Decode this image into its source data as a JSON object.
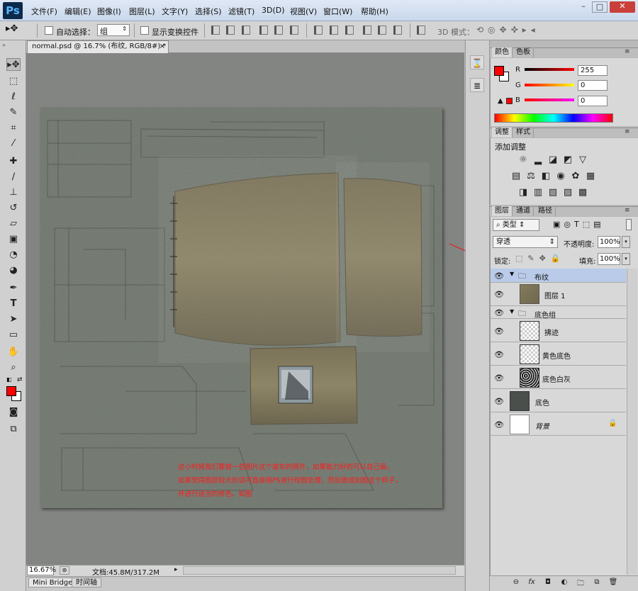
{
  "app": {
    "logo": "Ps"
  },
  "menu": [
    "文件(F)",
    "编辑(E)",
    "图像(I)",
    "图层(L)",
    "文字(Y)",
    "选择(S)",
    "滤镜(T)",
    "3D(D)",
    "视图(V)",
    "窗口(W)",
    "帮助(H)"
  ],
  "window_controls": {
    "minimize": "–",
    "maximize": "□",
    "close": "✕"
  },
  "options": {
    "auto_select_label": "自动选择：",
    "auto_select_value": "组",
    "show_transform_label": "显示变换控件",
    "mode_3d_label": "3D 模式："
  },
  "document": {
    "tab_title": "normal.psd @ 16.7% (布纹, RGB/8#) *",
    "annotation_lines": [
      "这小时候我们要做一些图片这个崖布的照片，如果能力好的可以自己画，",
      "如果觉得图层较大的话可直接用PS进行校图处理，然后做成如图这个样子，",
      "并进行适当的修色。如图"
    ],
    "zoom": "16.67%",
    "doc_info": "文档:45.8M/317.2M"
  },
  "bottom_tabs": [
    "Mini Bridge",
    "时间轴"
  ],
  "color_panel": {
    "tabs": [
      "颜色",
      "色板"
    ],
    "channels": [
      {
        "label": "R",
        "value": "255"
      },
      {
        "label": "G",
        "value": "0"
      },
      {
        "label": "B",
        "value": "0"
      }
    ],
    "foreground": "#ff0000"
  },
  "adjust_panel": {
    "tabs": [
      "调整",
      "样式"
    ],
    "title": "添加调整"
  },
  "layers_panel": {
    "tabs": [
      "图层",
      "通道",
      "路径"
    ],
    "filter_label": "类型",
    "blend_mode": "穿透",
    "opacity_label": "不透明度:",
    "opacity_value": "100%",
    "lock_label": "锁定:",
    "fill_label": "填充:",
    "fill_value": "100%",
    "layers": [
      {
        "name": "布纹",
        "kind": "group",
        "indent": 0,
        "selected": true
      },
      {
        "name": "图层 1",
        "kind": "layer",
        "indent": 1,
        "thumb": "cloth"
      },
      {
        "name": "底色组",
        "kind": "group",
        "indent": 1
      },
      {
        "name": "拂迹",
        "kind": "layer",
        "indent": 2,
        "thumb": "transparent"
      },
      {
        "name": "黄色底色",
        "kind": "layer",
        "indent": 2,
        "thumb": "transparent"
      },
      {
        "name": "底色白灰",
        "kind": "layer",
        "indent": 2,
        "thumb": "noise"
      },
      {
        "name": "底色",
        "kind": "layer",
        "indent": 0,
        "thumb": "dark"
      },
      {
        "name": "背景",
        "kind": "layer",
        "indent": 0,
        "thumb": "white",
        "locked": true
      }
    ]
  }
}
